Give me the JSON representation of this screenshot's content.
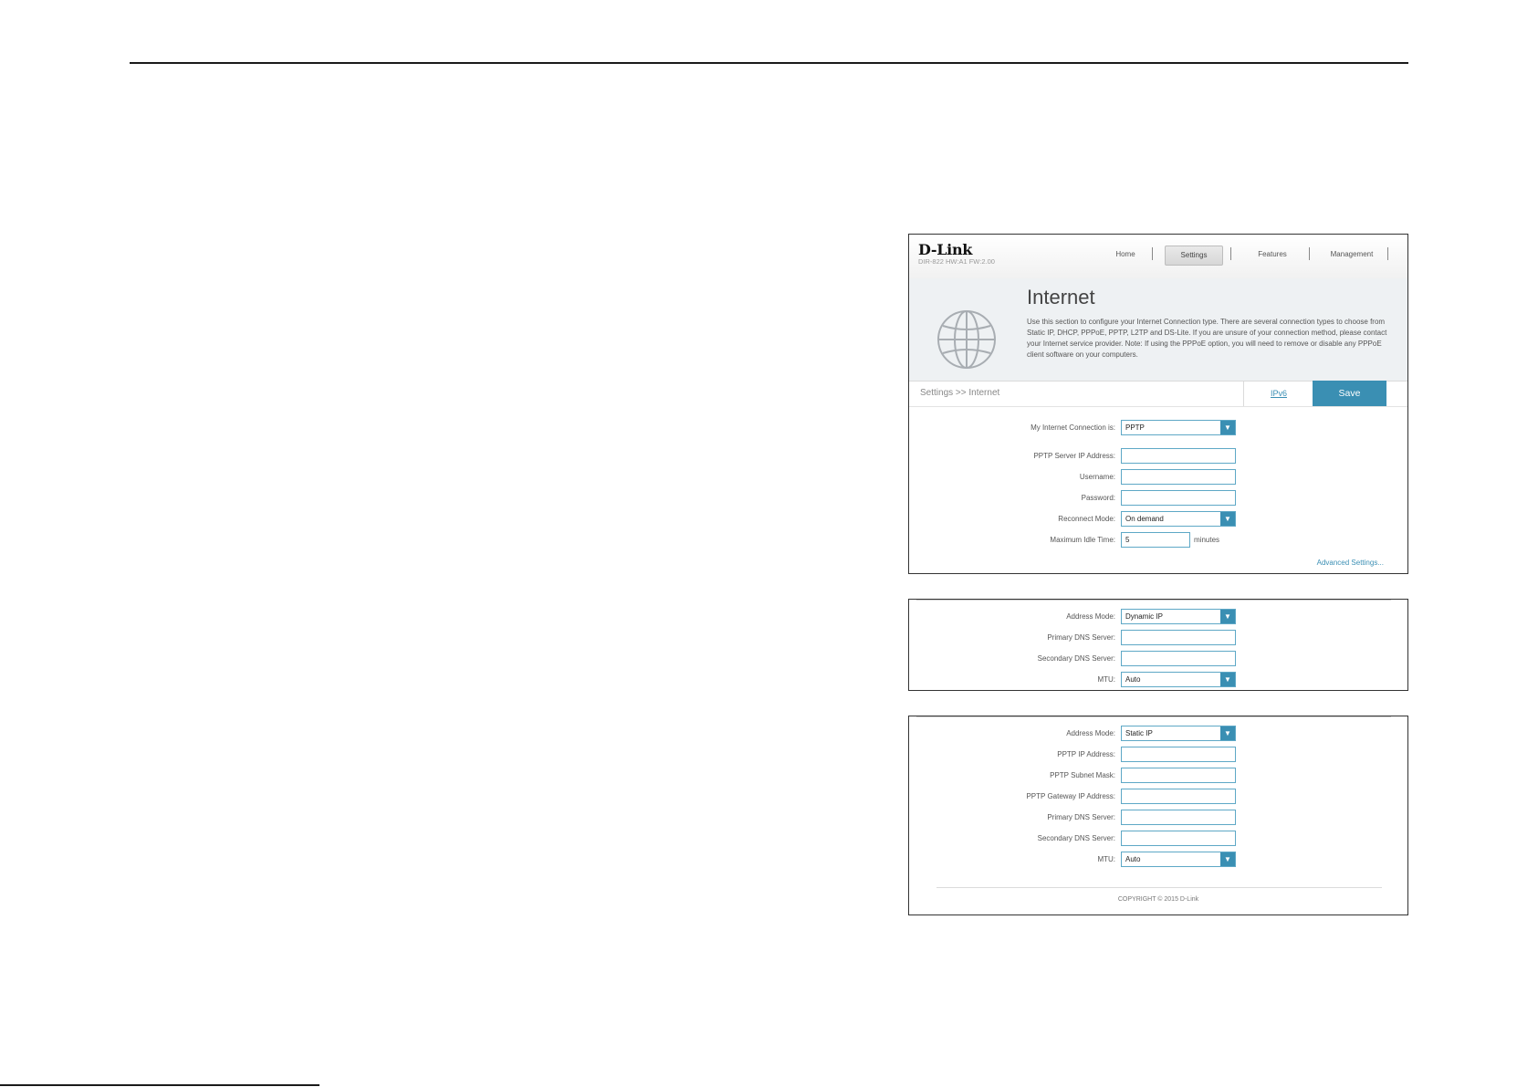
{
  "brand": {
    "logo": "D-Link",
    "model": "DIR-822 HW:A1 FW:2.00"
  },
  "nav": {
    "home": "Home",
    "settings": "Settings",
    "features": "Features",
    "management": "Management"
  },
  "banner": {
    "title": "Internet",
    "description": "Use this section to configure your Internet Connection type. There are several connection types to choose from Static IP, DHCP, PPPoE, PPTP, L2TP and DS-Lite. If you are unsure of your connection method, please contact your Internet service provider. Note: If using the PPPoE option, you will need to remove or disable any PPPoE client software on your computers."
  },
  "breadcrumb": "Settings >> Internet",
  "tabs": {
    "ipv6": "IPv6",
    "save": "Save"
  },
  "pptp_form": {
    "connection_label": "My Internet Connection is:",
    "connection_value": "PPTP",
    "server_ip_label": "PPTP Server IP Address:",
    "server_ip_value": "",
    "username_label": "Username:",
    "username_value": "",
    "password_label": "Password:",
    "password_value": "",
    "reconnect_label": "Reconnect Mode:",
    "reconnect_value": "On demand",
    "idle_label": "Maximum Idle Time:",
    "idle_value": "5",
    "idle_unit": "minutes",
    "advanced_link": "Advanced Settings..."
  },
  "dynamic_panel": {
    "address_mode_label": "Address Mode:",
    "address_mode_value": "Dynamic IP",
    "primary_dns_label": "Primary DNS Server:",
    "primary_dns_value": "",
    "secondary_dns_label": "Secondary DNS Server:",
    "secondary_dns_value": "",
    "mtu_label": "MTU:",
    "mtu_value": "Auto"
  },
  "static_panel": {
    "address_mode_label": "Address Mode:",
    "address_mode_value": "Static IP",
    "ip_label": "PPTP IP Address:",
    "ip_value": "",
    "subnet_label": "PPTP Subnet Mask:",
    "subnet_value": "",
    "gateway_label": "PPTP Gateway IP Address:",
    "gateway_value": "",
    "primary_dns_label": "Primary DNS Server:",
    "primary_dns_value": "",
    "secondary_dns_label": "Secondary DNS Server:",
    "secondary_dns_value": "",
    "mtu_label": "MTU:",
    "mtu_value": "Auto"
  },
  "copyright": "COPYRIGHT © 2015 D-Link",
  "icons": {
    "globe": "globe-icon",
    "dropdown": "chevron-down-icon"
  },
  "colors": {
    "accent": "#3a8fb3",
    "field_border": "#5ea8c6"
  }
}
